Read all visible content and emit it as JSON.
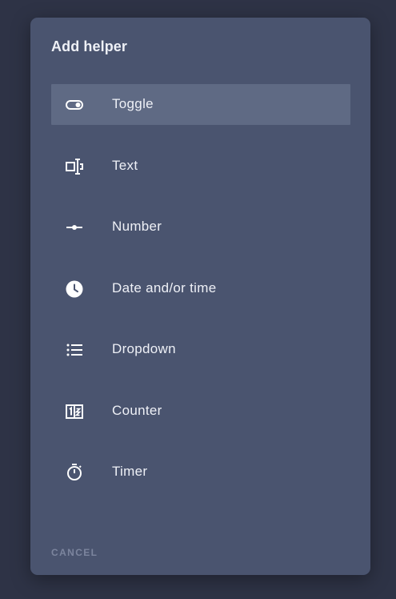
{
  "dialog": {
    "title": "Add helper",
    "cancel_label": "CANCEL"
  },
  "items": [
    {
      "label": "Toggle",
      "icon": "toggle-switch-icon",
      "selected": true
    },
    {
      "label": "Text",
      "icon": "text-cursor-icon",
      "selected": false
    },
    {
      "label": "Number",
      "icon": "slider-icon",
      "selected": false
    },
    {
      "label": "Date and/or time",
      "icon": "clock-icon",
      "selected": false
    },
    {
      "label": "Dropdown",
      "icon": "list-icon",
      "selected": false
    },
    {
      "label": "Counter",
      "icon": "counter-icon",
      "selected": false
    },
    {
      "label": "Timer",
      "icon": "timer-icon",
      "selected": false
    }
  ],
  "colors": {
    "backdrop": "#2e3346",
    "dialog": "#4a546f",
    "selected_row": "#5f6a84",
    "text": "#eef0f6",
    "muted": "#7c859e"
  }
}
